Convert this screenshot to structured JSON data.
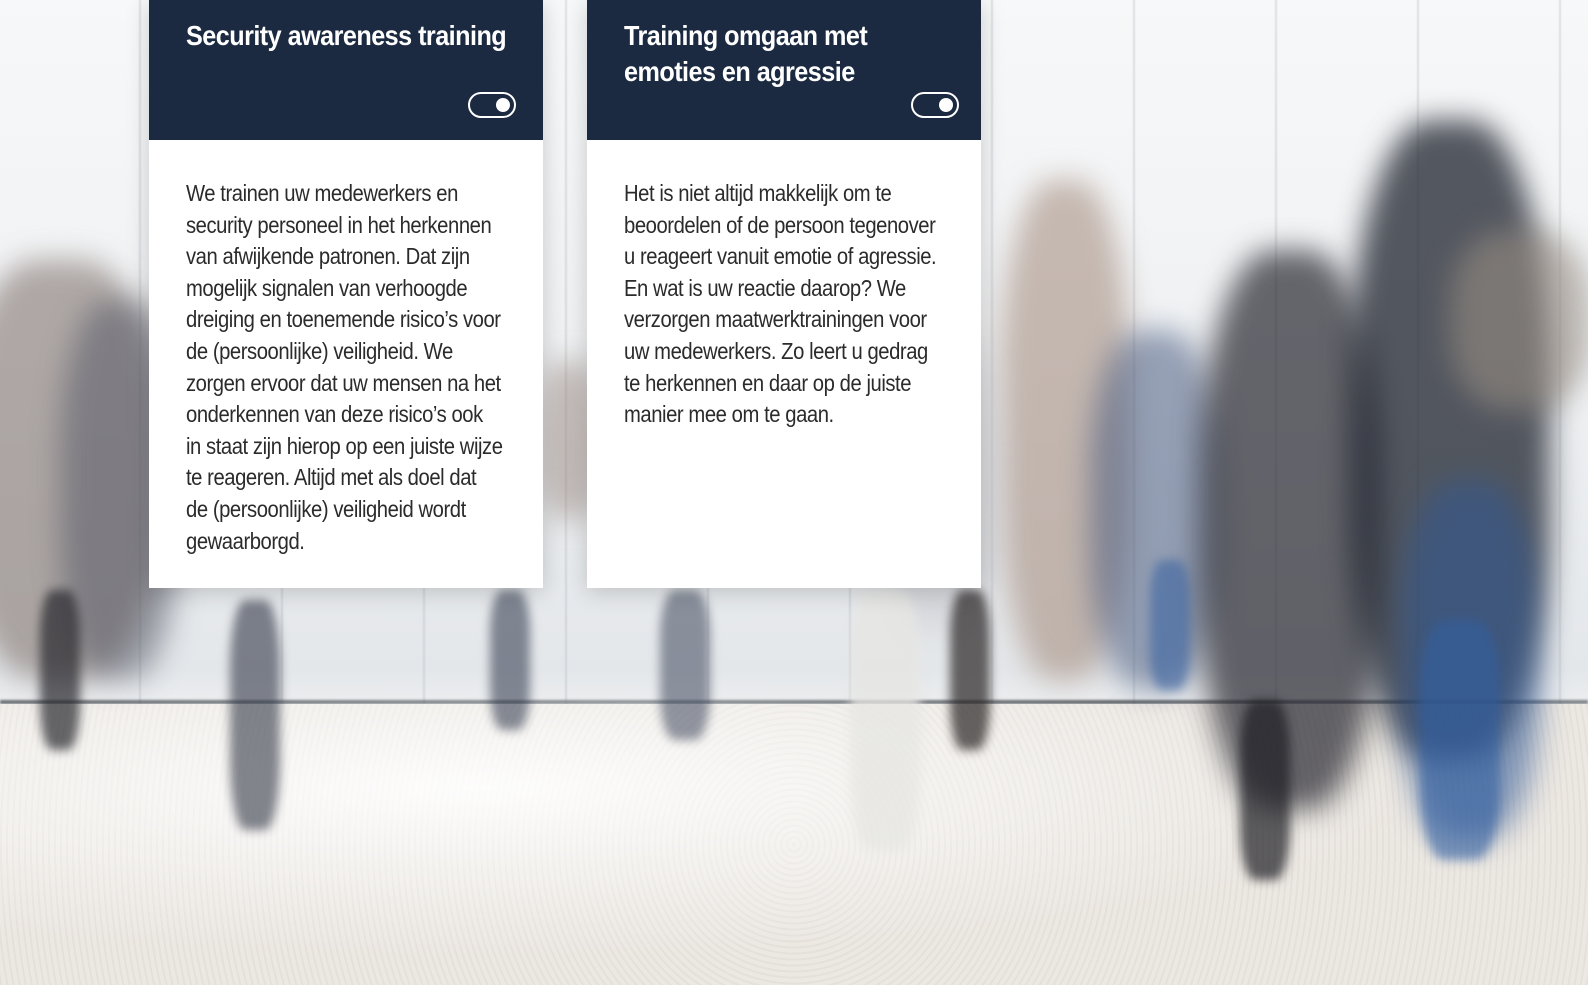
{
  "cards": [
    {
      "title": "Security awareness training",
      "body": "We trainen uw medewerkers en security personeel in het herkennen van afwijkende patronen. Dat zijn mogelijk signalen van verhoogde dreiging en toenemende risico’s voor de (persoonlijke) veiligheid. We zorgen ervoor dat uw mensen na het onderkennen van deze risico’s ook in staat zijn hierop op een juiste wijze te reageren. Altijd met als doel dat de (persoonlijke) veiligheid wordt gewaarborgd.",
      "toggle_icon": "toggle-on-icon"
    },
    {
      "title": "Training omgaan met emoties en agressie",
      "body": "Het is niet altijd makkelijk om te beoordelen of de persoon tegenover u reageert vanuit emotie of agressie. En wat is uw reactie daarop? We verzorgen maatwerktrainingen voor uw medewerkers. Zo leert u gedrag te herkennen en daar op de juiste manier mee om te gaan.",
      "toggle_icon": "toggle-on-icon"
    }
  ],
  "colors": {
    "card_header": "#1b2a41",
    "card_body": "#ffffff",
    "body_text": "#2b2b2b",
    "title_text": "#ffffff"
  },
  "background": {
    "image": "blurred-commuters-photo"
  }
}
